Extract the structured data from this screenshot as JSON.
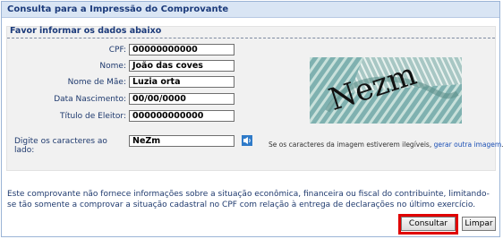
{
  "window": {
    "title": "Consulta para a Impressão do Comprovante"
  },
  "section": {
    "header": "Favor informar os dados abaixo"
  },
  "form": {
    "cpf": {
      "label": "CPF:",
      "value": "00000000000"
    },
    "nome": {
      "label": "Nome:",
      "value": "João das coves"
    },
    "nome_mae": {
      "label": "Nome de Mãe:",
      "value": "Luzia orta"
    },
    "data_nascimento": {
      "label": "Data Nascimento:",
      "value": "00/00/0000"
    },
    "titulo_eleitor": {
      "label": "Título de Eleitor:",
      "value": "000000000000"
    },
    "captcha": {
      "label": "Digite os caracteres ao lado:",
      "value": "NeZm"
    }
  },
  "captcha_image": {
    "text": "Nezm"
  },
  "captcha_note": {
    "text": "Se os caracteres da imagem estiverem ilegíveis, ",
    "link": "gerar outra imagem",
    "suffix": "."
  },
  "info_text": "Este comprovante não fornece informações sobre a situação econômica, financeira ou fiscal do contribuinte, limitando-se tão somente a comprovar a situação cadastral no CPF com relação à entrega de declarações no último exercício.",
  "buttons": {
    "consultar": "Consultar",
    "limpar": "Limpar"
  },
  "icons": {
    "audio": "audio-captcha-icon"
  },
  "colors": {
    "title_bg": "#d9e5f4",
    "highlight": "#e00000",
    "link": "#1b4fb5"
  }
}
